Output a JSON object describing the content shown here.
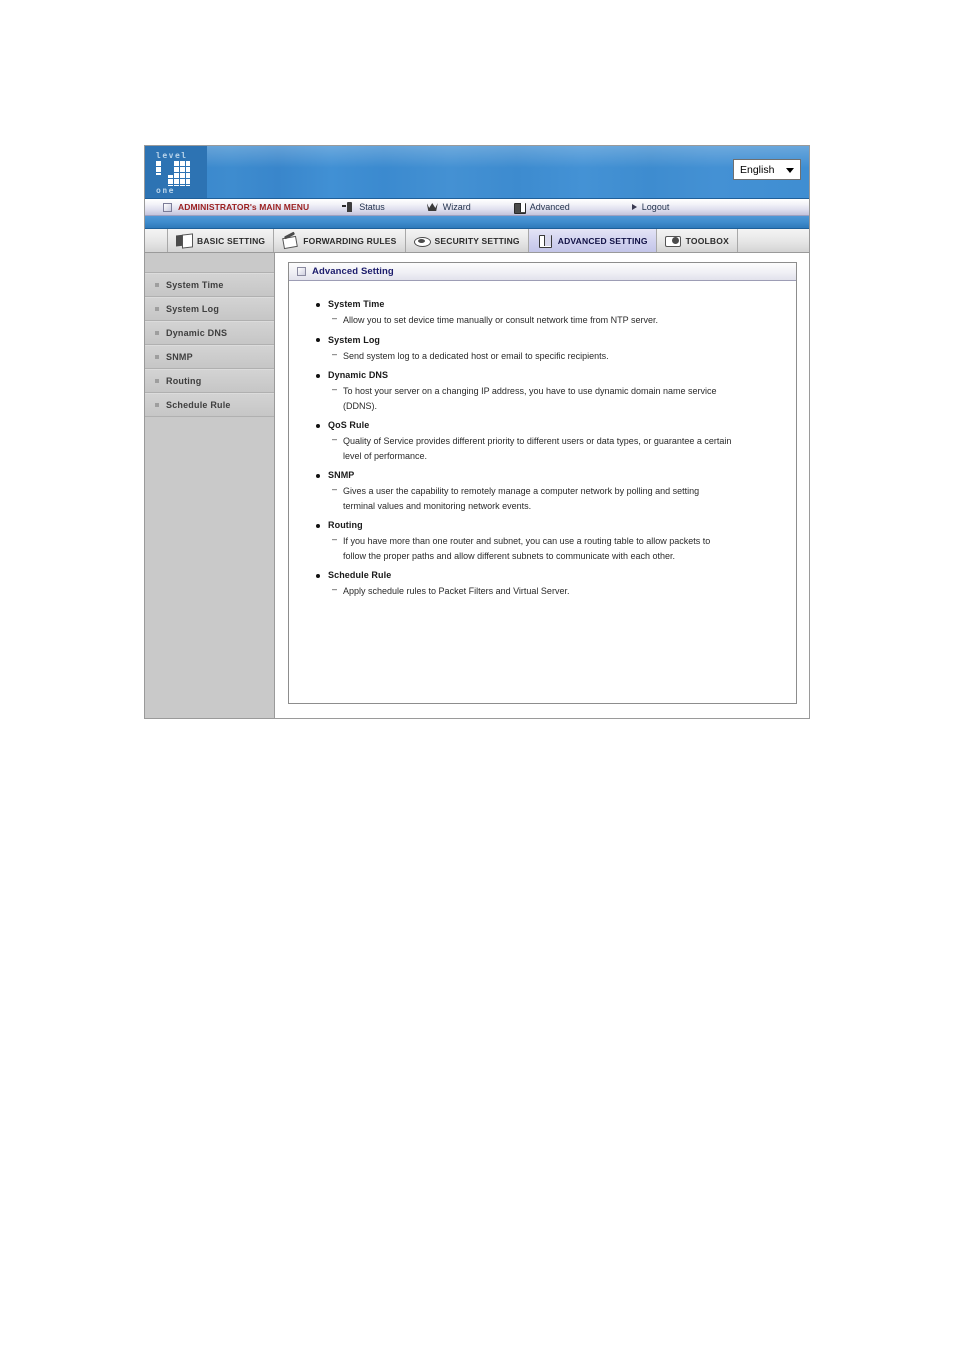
{
  "banner": {
    "logo": {
      "top_word": "level",
      "bottom_word": "one",
      "mark_digit": "1"
    },
    "language": {
      "selected": "English",
      "icon": "chevron-down-icon"
    }
  },
  "main_menu": {
    "items": [
      {
        "label": "ADMINISTRATOR's MAIN MENU",
        "icon": "square-icon"
      },
      {
        "label": "Status",
        "icon": "status-icon"
      },
      {
        "label": "Wizard",
        "icon": "wizard-hat-icon"
      },
      {
        "label": "Advanced",
        "icon": "cube-icon"
      },
      {
        "label": "Logout",
        "icon": "triangle-right-icon"
      }
    ]
  },
  "tabs": [
    {
      "label": "BASIC SETTING",
      "icon": "folder-icon",
      "active": false
    },
    {
      "label": "FORWARDING RULES",
      "icon": "pen-paper-icon",
      "active": false
    },
    {
      "label": "SECURITY SETTING",
      "icon": "lock-oval-icon",
      "active": false
    },
    {
      "label": "ADVANCED SETTING",
      "icon": "cube-icon",
      "active": true
    },
    {
      "label": "TOOLBOX",
      "icon": "toolbox-gear-icon",
      "active": false
    }
  ],
  "sidebar": {
    "items": [
      {
        "label": "System Time"
      },
      {
        "label": "System Log"
      },
      {
        "label": "Dynamic DNS"
      },
      {
        "label": "SNMP"
      },
      {
        "label": "Routing"
      },
      {
        "label": "Schedule Rule"
      }
    ]
  },
  "panel": {
    "title": "Advanced Setting",
    "title_icon": "square-icon",
    "entries": [
      {
        "heading": "System Time",
        "description": "Allow you to set device time manually or consult network time from NTP server."
      },
      {
        "heading": "System Log",
        "description": "Send system log to a dedicated host or email to specific recipients."
      },
      {
        "heading": "Dynamic DNS",
        "description": "To host your server on a changing IP address, you have to use dynamic domain name service (DDNS)."
      },
      {
        "heading": "QoS Rule",
        "description": "Quality of Service provides different priority to different users or data types, or guarantee a certain level of performance."
      },
      {
        "heading": "SNMP",
        "description": "Gives a user the capability to remotely manage a computer network by polling and setting terminal values and monitoring network events."
      },
      {
        "heading": "Routing",
        "description": "If you have more than one router and subnet, you can use a routing table to allow packets to follow the proper paths and allow different subnets to communicate with each other."
      },
      {
        "heading": "Schedule Rule",
        "description": "Apply schedule rules to Packet Filters and Virtual Server."
      }
    ]
  },
  "colors": {
    "banner_blue": "#3f8ccd",
    "logo_blue": "#2d73b3",
    "admin_red": "#9b2020",
    "panel_title_navy": "#1b1b6b",
    "active_tab": "#cfd0ee",
    "sidebar_gray": "#c9c9c9"
  }
}
